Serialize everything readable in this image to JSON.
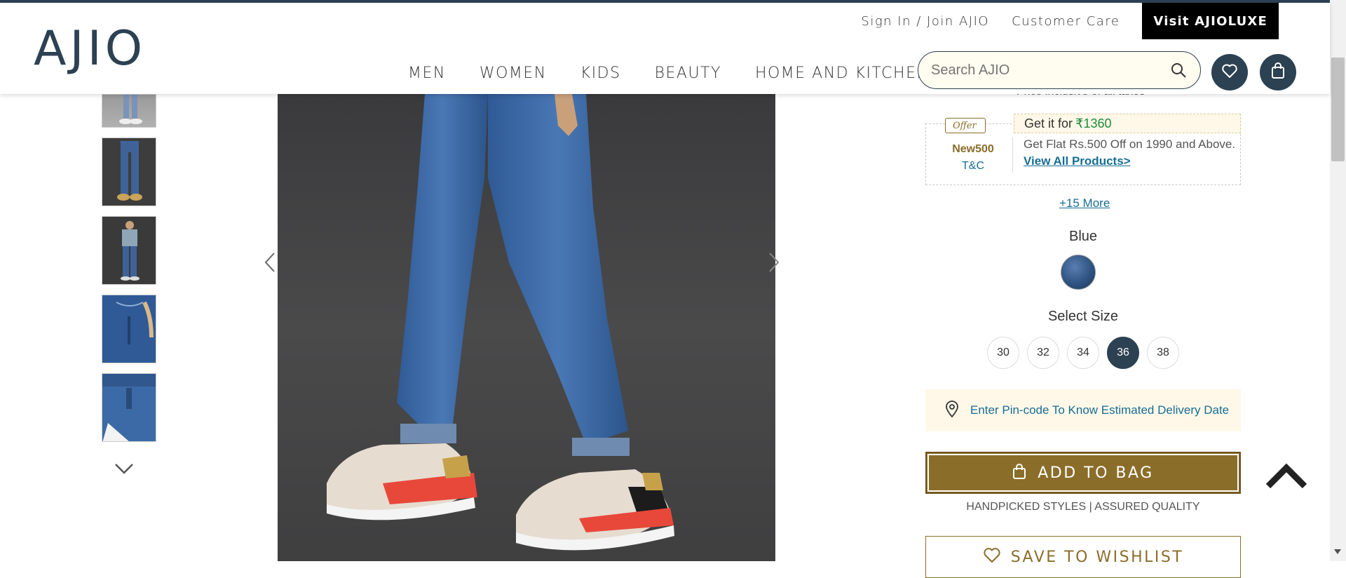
{
  "header": {
    "logo": "AJIO",
    "util_links": [
      "Sign In / Join AJIO",
      "Customer Care"
    ],
    "luxe_button": "Visit AJIOLUXE",
    "nav": [
      "MEN",
      "WOMEN",
      "KIDS",
      "BEAUTY",
      "HOME AND KITCHEN"
    ],
    "search_placeholder": "Search AJIO"
  },
  "product": {
    "price_note": "Price inclusive of all taxes",
    "offer": {
      "tag": "Offer",
      "code": "New500",
      "tc": "T&C",
      "get_it_for": "Get it for",
      "offer_price": "₹1360",
      "description": "Get Flat Rs.500 Off on 1990 and Above.",
      "link": "View All Products>"
    },
    "more_offers": "+15 More",
    "color_name": "Blue",
    "size_label": "Select Size",
    "sizes": [
      "30",
      "32",
      "34",
      "36",
      "38"
    ],
    "selected_size": "36",
    "pincode_text": "Enter Pin-code To Know Estimated Delivery Date",
    "add_to_bag": "ADD TO BAG",
    "assurance": "HANDPICKED STYLES | ASSURED QUALITY",
    "save_wishlist": "SAVE TO WISHLIST"
  },
  "colors": {
    "brand_dark": "#2c4152",
    "gold": "#8b6d2a",
    "link_blue": "#176d93",
    "offer_green": "#1a8a3a"
  }
}
